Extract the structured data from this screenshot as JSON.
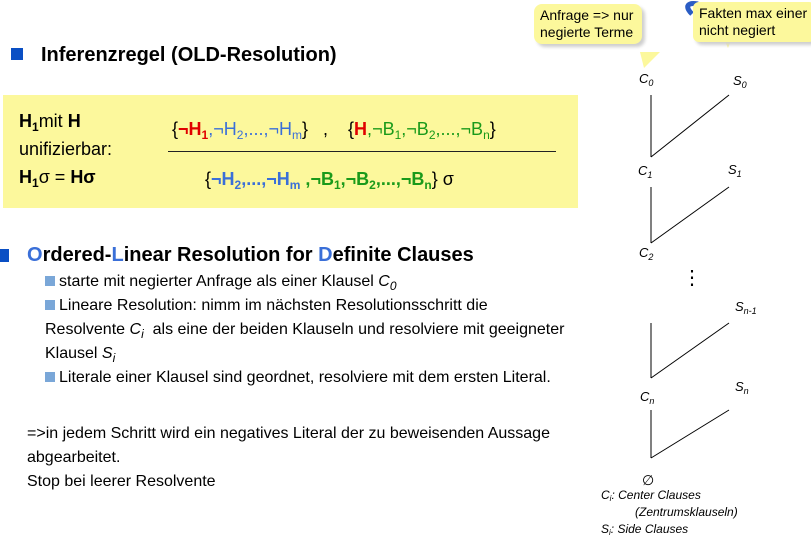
{
  "heading1": {
    "text": "Inferenzregel (OLD-Resolution)"
  },
  "rule": {
    "left_line1_a": "H",
    "left_line1_sub": "1",
    "left_line1_b": "mit ",
    "left_line1_c": "H",
    "left_line2": "unifizierbar:",
    "left_line3_a": "H",
    "left_line3_sub": "1",
    "left_line3_b": "σ = ",
    "left_line3_c": "Hσ",
    "top": {
      "brace_open": "{",
      "neg_h1": "¬H",
      "neg_h1_sub": "1",
      "comma1": ",",
      "neg_h2": "¬H",
      "neg_h2_sub": "2",
      "dots1": ",...,",
      "neg_hm": "¬H",
      "neg_hm_sub": "m",
      "brace_close": "}",
      "sep": ",",
      "brace2_open": "{",
      "h": "H",
      "comma2": ",",
      "neg_b1": "¬B",
      "neg_b1_sub": "1",
      "comma3": ",",
      "neg_b2": "¬B",
      "neg_b2_sub": "2",
      "dots2": ",...,",
      "neg_bn": "¬B",
      "neg_bn_sub": "n",
      "brace2_close": "}"
    },
    "bottom": {
      "brace_open": "{",
      "neg_h2": "¬H",
      "neg_h2_sub": "2",
      "dots1": ",...,",
      "neg_hm": "¬H",
      "neg_hm_sub": "m",
      "comma1": " ,",
      "neg_b1": "¬B",
      "neg_b1_sub": "1",
      "comma2": ",",
      "neg_b2": "¬B",
      "neg_b2_sub": "2",
      "dots2": ",...,",
      "neg_bn": "¬B",
      "neg_bn_sub": "n",
      "brace_close": "}",
      "sigma": " σ"
    }
  },
  "heading2": {
    "o": "O",
    "o_rest": "rdered-",
    "l": "L",
    "l_rest": "inear Resolution for ",
    "d": "D",
    "d_rest": "efinite Clauses"
  },
  "bullets": {
    "b1_text": "starte mit negierter Anfrage als einer Klausel ",
    "b1_var": "C",
    "b1_sub": "0",
    "b2_line1": "Lineare Resolution: nimm im nächsten Resolutionsschritt die",
    "b2_line2_a": "Resolvente ",
    "b2_line2_var": "C",
    "b2_line2_sub": "i",
    "b2_line2_b": "  als eine der beiden Klauseln und resolviere mit geeigneter",
    "b2_line3_a": "Klausel ",
    "b2_line3_var": "S",
    "b2_line3_sub": "i",
    "b3_text": "Literale einer Klausel sind geordnet, resolviere mit dem ersten Literal."
  },
  "conclusion": {
    "line1": "=>in jedem Schritt wird ein negatives Literal der zu beweisenden Aussage",
    "line2": "abgearbeitet.",
    "line3": "Stop bei leerer Resolvente"
  },
  "callouts": {
    "left_line1": "Anfrage => nur",
    "left_line2": "negierte Terme",
    "right_line1": "Fakten max einer",
    "right_line2": "nicht negiert"
  },
  "diagram": {
    "c0": "C",
    "c0_sub": "0",
    "s0": "S",
    "s0_sub": "0",
    "c1": "C",
    "c1_sub": "1",
    "s1": "S",
    "s1_sub": "1",
    "c2": "C",
    "c2_sub": "2",
    "vdots": "⋮",
    "sn1": "S",
    "sn1_sub": "n-1",
    "cn": "C",
    "cn_sub": "n",
    "sn": "S",
    "sn_sub": "n",
    "empty": "∅"
  },
  "legend": {
    "ci_var": "C",
    "ci_sub": "i",
    "ci_text": ": Center Clauses",
    "ci_text2": "(Zentrumsklauseln)",
    "si_var": "S",
    "si_sub": "i",
    "si_text": ": Side Clauses"
  },
  "colors": {
    "accent_blue": "#0a4fc4",
    "box_yellow": "#fcf89c",
    "red": "#e00000",
    "blue": "#3a6fd8",
    "green": "#1a9a1a"
  }
}
